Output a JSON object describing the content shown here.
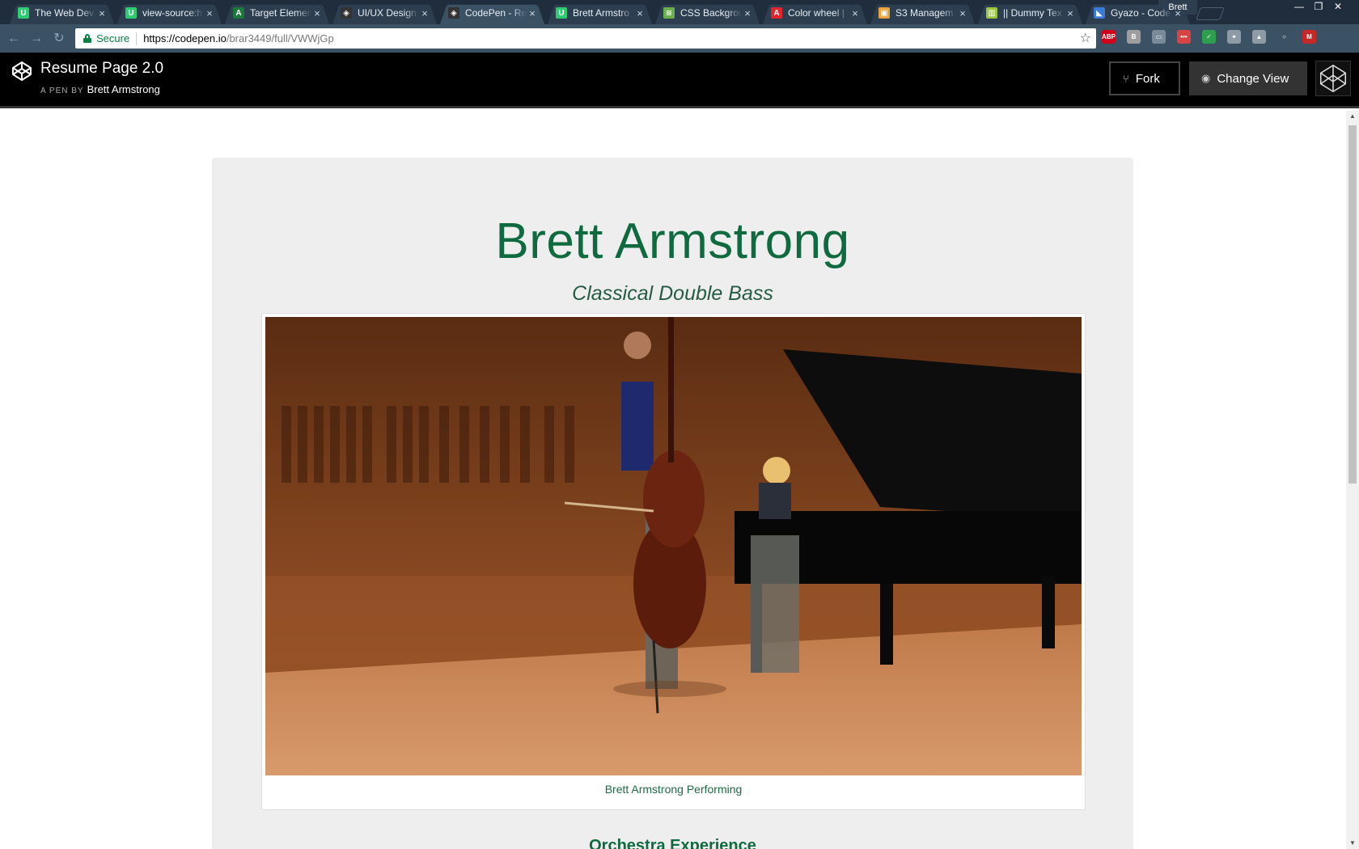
{
  "browser": {
    "tabs": [
      {
        "title": "The Web Dev",
        "favicon": "U",
        "color": "#2ecc71"
      },
      {
        "title": "view-source:h",
        "favicon": "U",
        "color": "#2ecc71"
      },
      {
        "title": "Target Elemen",
        "favicon": "A",
        "color": "#1b7a3a"
      },
      {
        "title": "UI/UX Design",
        "favicon": "◈",
        "color": "#333333"
      },
      {
        "title": "CodePen - Re",
        "favicon": "◈",
        "color": "#333333"
      },
      {
        "title": "Brett Armstro",
        "favicon": "U",
        "color": "#2ecc71"
      },
      {
        "title": "CSS Backgrou",
        "favicon": "≋",
        "color": "#6ab04c"
      },
      {
        "title": "Color wheel |",
        "favicon": "A",
        "color": "#e3242b"
      },
      {
        "title": "S3 Managem",
        "favicon": "▣",
        "color": "#e8a33c"
      },
      {
        "title": "|| Dummy Tex",
        "favicon": "▥",
        "color": "#9bc53d"
      },
      {
        "title": "Gyazo - Code",
        "favicon": "◣",
        "color": "#3a7bd5"
      }
    ],
    "active_tab_index": 4,
    "profile_name": "Brett",
    "security_label": "Secure",
    "url_host": "https://codepen.io",
    "url_path": "/brar3449/full/VWWjGp",
    "extensions": [
      {
        "name": "adblock-icon",
        "label": "ABP",
        "color": "#d0021b"
      },
      {
        "name": "b-extension-icon",
        "label": "B",
        "color": "#9e9e9e"
      },
      {
        "name": "screen-extension-icon",
        "label": "▭",
        "color": "#7a8a99"
      },
      {
        "name": "todo-extension-icon",
        "label": "•••",
        "color": "#d84343"
      },
      {
        "name": "green-extension-icon",
        "label": "✓",
        "color": "#2e9e4f"
      },
      {
        "name": "pin-extension-icon",
        "label": "⌖",
        "color": "#8e9aa6"
      },
      {
        "name": "drive-extension-icon",
        "label": "▲",
        "color": "#8e9aa6"
      },
      {
        "name": "circle-extension-icon",
        "label": "○",
        "color": "#3b5164"
      },
      {
        "name": "m-extension-icon",
        "label": "M",
        "color": "#c62828"
      }
    ]
  },
  "codepen": {
    "pen_title": "Resume Page 2.0",
    "pen_by_label": "A PEN BY",
    "author": "Brett Armstrong",
    "fork_label": "Fork",
    "change_view_label": "Change View"
  },
  "resume": {
    "name": "Brett Armstrong",
    "subtitle": "Classical Double Bass",
    "image_caption": "Brett Armstrong Performing",
    "section_heading": "Orchestra Experience"
  },
  "colors": {
    "title_green": "#0f6b3f",
    "card_bg": "#eeeeee",
    "header_bg": "#000000"
  }
}
